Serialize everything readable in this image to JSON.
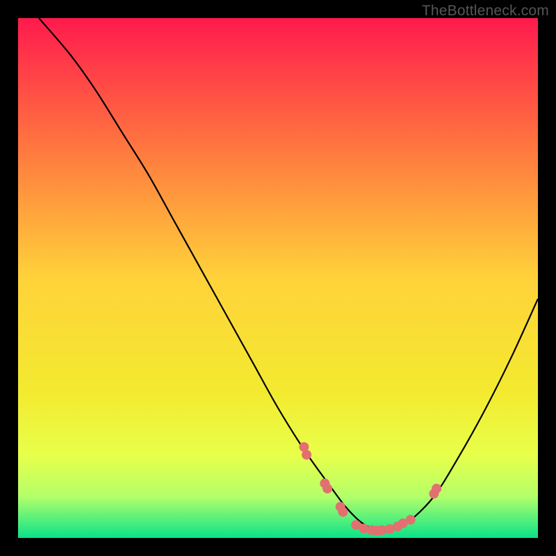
{
  "watermark": "TheBottleneck.com",
  "chart_data": {
    "type": "line",
    "title": "",
    "xlabel": "",
    "ylabel": "",
    "xlim": [
      0,
      100
    ],
    "ylim": [
      0,
      100
    ],
    "grid": false,
    "legend": false,
    "series": [
      {
        "name": "curve",
        "x": [
          4,
          10,
          15,
          20,
          25,
          30,
          35,
          40,
          45,
          50,
          55,
          60,
          63,
          66,
          69,
          72,
          75,
          80,
          85,
          90,
          95,
          100
        ],
        "y": [
          100,
          93,
          86,
          78,
          70,
          61,
          52,
          43,
          34,
          25,
          17,
          10,
          6,
          3,
          1.5,
          1.5,
          3,
          8,
          16,
          25,
          35,
          46
        ]
      }
    ],
    "scatter_points": {
      "name": "markers",
      "color": "#e27070",
      "x": [
        55.0,
        55.5,
        59.0,
        59.5,
        62.0,
        62.5,
        65.0,
        66.5,
        68.0,
        69.0,
        70.0,
        71.5,
        73.0,
        74.0,
        75.5,
        80.0,
        80.5
      ],
      "y": [
        17.5,
        16.0,
        10.5,
        9.5,
        6.0,
        5.0,
        2.5,
        1.8,
        1.5,
        1.4,
        1.5,
        1.7,
        2.2,
        2.8,
        3.5,
        8.5,
        9.5
      ]
    },
    "background_gradient": {
      "stops": [
        {
          "offset": 0.0,
          "color": "#ff1a4d"
        },
        {
          "offset": 0.25,
          "color": "#ff773f"
        },
        {
          "offset": 0.5,
          "color": "#ffd23a"
        },
        {
          "offset": 0.72,
          "color": "#f3ea2f"
        },
        {
          "offset": 0.84,
          "color": "#e8ff4a"
        },
        {
          "offset": 0.92,
          "color": "#b4ff6a"
        },
        {
          "offset": 1.0,
          "color": "#09e38a"
        }
      ]
    }
  }
}
